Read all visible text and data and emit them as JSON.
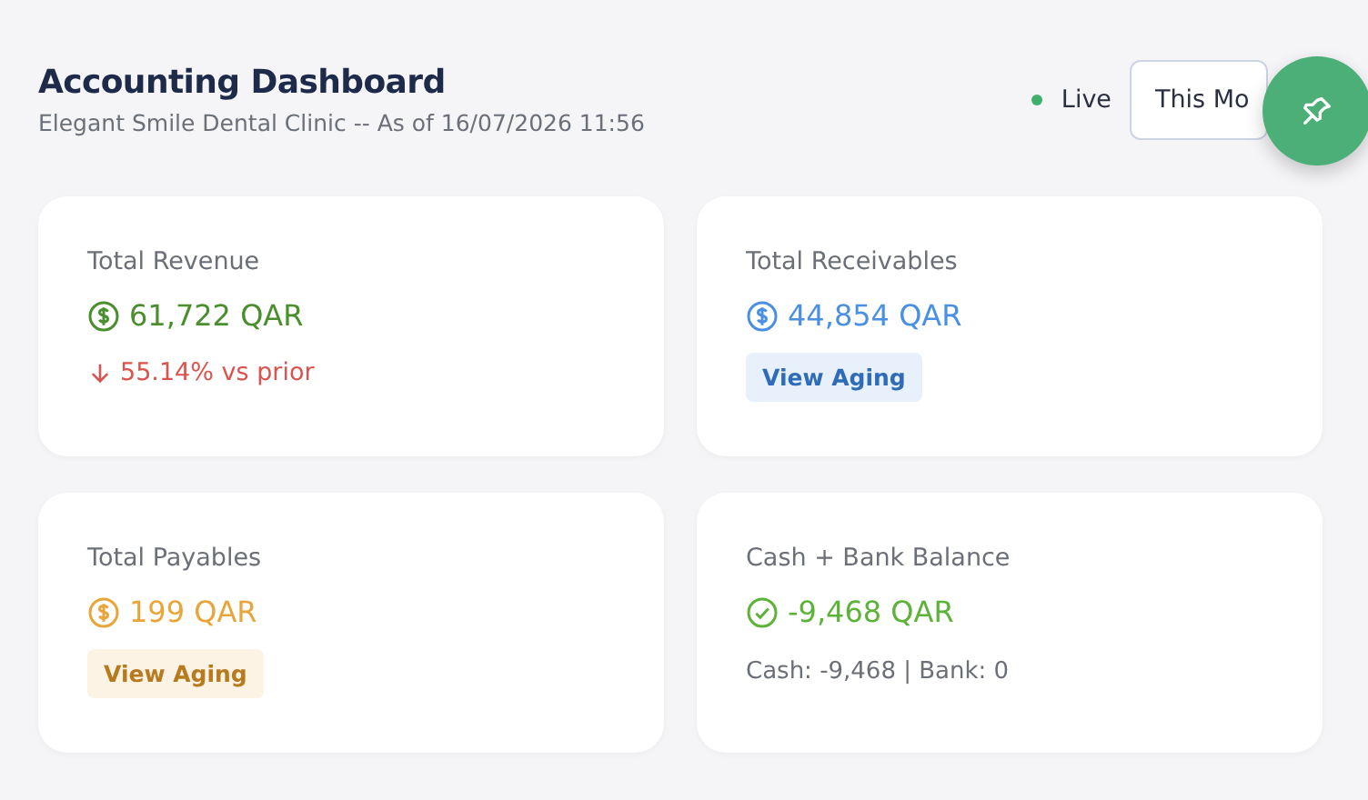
{
  "header": {
    "title": "Accounting Dashboard",
    "subtitle": "Elegant Smile Dental Clinic -- As of 16/07/2026 11:56",
    "live": {
      "label": "Live",
      "on": true
    },
    "period": {
      "value": "This Mo"
    }
  },
  "cards": [
    {
      "title": "Total Revenue",
      "value": "61,722 QAR",
      "kind": "money",
      "color": "#4a8f2e",
      "footer": {
        "kind": "trend",
        "text": "55.14% vs prior"
      }
    },
    {
      "title": "Total Receivables",
      "value": "44,854 QAR",
      "kind": "money",
      "color": "#4a90e2",
      "footer": {
        "kind": "button",
        "text": "View Aging"
      }
    },
    {
      "title": "Total Payables",
      "value": "199 QAR",
      "kind": "money",
      "color": "#e8a53a",
      "footer": {
        "kind": "button",
        "text": "View Aging"
      }
    },
    {
      "title": "Cash + Bank Balance",
      "value": "-9,468 QAR",
      "kind": "balance",
      "color": "#5cb338",
      "footer": {
        "kind": "note",
        "text": "Cash: -9,468 | Bank: 0"
      }
    }
  ]
}
